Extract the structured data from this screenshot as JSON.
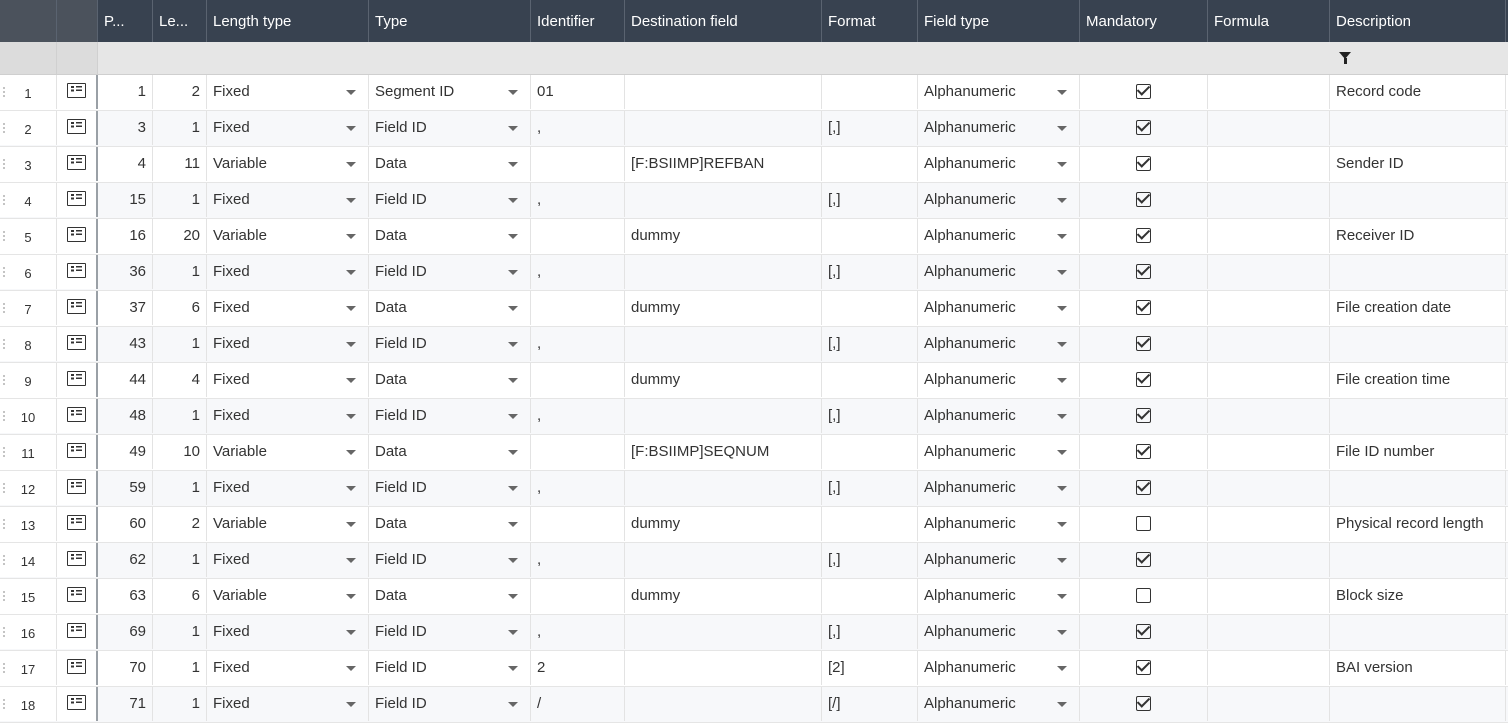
{
  "columns": [
    {
      "key": "rownum",
      "label": ""
    },
    {
      "key": "detail",
      "label": ""
    },
    {
      "key": "position",
      "label": "P..."
    },
    {
      "key": "length",
      "label": "Le..."
    },
    {
      "key": "length_type",
      "label": "Length type"
    },
    {
      "key": "type",
      "label": "Type"
    },
    {
      "key": "identifier",
      "label": "Identifier"
    },
    {
      "key": "destination",
      "label": "Destination field"
    },
    {
      "key": "format",
      "label": "Format"
    },
    {
      "key": "field_type",
      "label": "Field type"
    },
    {
      "key": "mandatory",
      "label": "Mandatory"
    },
    {
      "key": "formula",
      "label": "Formula"
    },
    {
      "key": "description",
      "label": "Description"
    }
  ],
  "rows": [
    {
      "no": "1",
      "position": "1",
      "length": "2",
      "length_type": "Fixed",
      "type": "Segment ID",
      "identifier": "01",
      "destination": "",
      "format": "",
      "field_type": "Alphanumeric",
      "mandatory": true,
      "formula": "",
      "description": "Record code"
    },
    {
      "no": "2",
      "position": "3",
      "length": "1",
      "length_type": "Fixed",
      "type": "Field ID",
      "identifier": ",",
      "destination": "",
      "format": "[,]",
      "field_type": "Alphanumeric",
      "mandatory": true,
      "formula": "",
      "description": ""
    },
    {
      "no": "3",
      "position": "4",
      "length": "11",
      "length_type": "Variable",
      "type": "Data",
      "identifier": "",
      "destination": "[F:BSIIMP]REFBAN",
      "format": "",
      "field_type": "Alphanumeric",
      "mandatory": true,
      "formula": "",
      "description": "Sender ID"
    },
    {
      "no": "4",
      "position": "15",
      "length": "1",
      "length_type": "Fixed",
      "type": "Field ID",
      "identifier": ",",
      "destination": "",
      "format": "[,]",
      "field_type": "Alphanumeric",
      "mandatory": true,
      "formula": "",
      "description": ""
    },
    {
      "no": "5",
      "position": "16",
      "length": "20",
      "length_type": "Variable",
      "type": "Data",
      "identifier": "",
      "destination": "dummy",
      "format": "",
      "field_type": "Alphanumeric",
      "mandatory": true,
      "formula": "",
      "description": "Receiver ID"
    },
    {
      "no": "6",
      "position": "36",
      "length": "1",
      "length_type": "Fixed",
      "type": "Field ID",
      "identifier": ",",
      "destination": "",
      "format": "[,]",
      "field_type": "Alphanumeric",
      "mandatory": true,
      "formula": "",
      "description": ""
    },
    {
      "no": "7",
      "position": "37",
      "length": "6",
      "length_type": "Fixed",
      "type": "Data",
      "identifier": "",
      "destination": "dummy",
      "format": "",
      "field_type": "Alphanumeric",
      "mandatory": true,
      "formula": "",
      "description": "File creation date"
    },
    {
      "no": "8",
      "position": "43",
      "length": "1",
      "length_type": "Fixed",
      "type": "Field ID",
      "identifier": ",",
      "destination": "",
      "format": "[,]",
      "field_type": "Alphanumeric",
      "mandatory": true,
      "formula": "",
      "description": ""
    },
    {
      "no": "9",
      "position": "44",
      "length": "4",
      "length_type": "Fixed",
      "type": "Data",
      "identifier": "",
      "destination": "dummy",
      "format": "",
      "field_type": "Alphanumeric",
      "mandatory": true,
      "formula": "",
      "description": "File creation time"
    },
    {
      "no": "10",
      "position": "48",
      "length": "1",
      "length_type": "Fixed",
      "type": "Field ID",
      "identifier": ",",
      "destination": "",
      "format": "[,]",
      "field_type": "Alphanumeric",
      "mandatory": true,
      "formula": "",
      "description": ""
    },
    {
      "no": "11",
      "position": "49",
      "length": "10",
      "length_type": "Variable",
      "type": "Data",
      "identifier": "",
      "destination": "[F:BSIIMP]SEQNUM",
      "format": "",
      "field_type": "Alphanumeric",
      "mandatory": true,
      "formula": "",
      "description": "File ID number"
    },
    {
      "no": "12",
      "position": "59",
      "length": "1",
      "length_type": "Fixed",
      "type": "Field ID",
      "identifier": ",",
      "destination": "",
      "format": "[,]",
      "field_type": "Alphanumeric",
      "mandatory": true,
      "formula": "",
      "description": ""
    },
    {
      "no": "13",
      "position": "60",
      "length": "2",
      "length_type": "Variable",
      "type": "Data",
      "identifier": "",
      "destination": "dummy",
      "format": "",
      "field_type": "Alphanumeric",
      "mandatory": false,
      "formula": "",
      "description": "Physical record length"
    },
    {
      "no": "14",
      "position": "62",
      "length": "1",
      "length_type": "Fixed",
      "type": "Field ID",
      "identifier": ",",
      "destination": "",
      "format": "[,]",
      "field_type": "Alphanumeric",
      "mandatory": true,
      "formula": "",
      "description": ""
    },
    {
      "no": "15",
      "position": "63",
      "length": "6",
      "length_type": "Variable",
      "type": "Data",
      "identifier": "",
      "destination": "dummy",
      "format": "",
      "field_type": "Alphanumeric",
      "mandatory": false,
      "formula": "",
      "description": "Block size"
    },
    {
      "no": "16",
      "position": "69",
      "length": "1",
      "length_type": "Fixed",
      "type": "Field ID",
      "identifier": ",",
      "destination": "",
      "format": "[,]",
      "field_type": "Alphanumeric",
      "mandatory": true,
      "formula": "",
      "description": ""
    },
    {
      "no": "17",
      "position": "70",
      "length": "1",
      "length_type": "Fixed",
      "type": "Field ID",
      "identifier": "2",
      "destination": "",
      "format": "[2]",
      "field_type": "Alphanumeric",
      "mandatory": true,
      "formula": "",
      "description": "BAI version"
    },
    {
      "no": "18",
      "position": "71",
      "length": "1",
      "length_type": "Fixed",
      "type": "Field ID",
      "identifier": "/",
      "destination": "",
      "format": "[/]",
      "field_type": "Alphanumeric",
      "mandatory": true,
      "formula": "",
      "description": ""
    }
  ],
  "icons": {
    "filter": "filter-icon",
    "row_detail": "row-detail-icon",
    "dropdown": "chevron-down-icon",
    "drag": "drag-handle-icon"
  },
  "colors": {
    "header_bg": "#384250",
    "header_text": "#ffffff",
    "filter_bg": "#e6e6e6",
    "zebra": "#f7f8fa"
  }
}
